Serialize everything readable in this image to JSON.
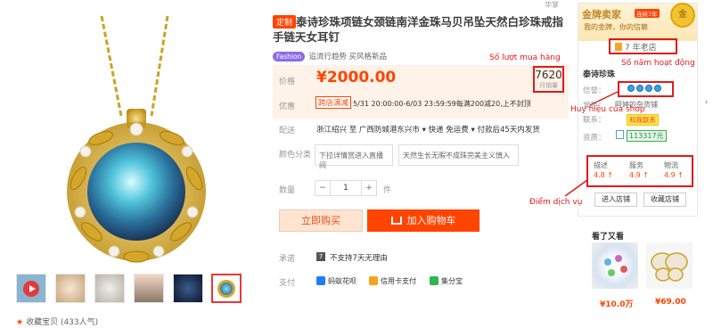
{
  "product": {
    "tag": "定制",
    "title": "泰诗珍珠项链女颈链南洋金珠马贝吊坠天然白珍珠戒指手链天女耳钉",
    "edge_text": "华掌",
    "trend": {
      "badge": "Fashion",
      "text": "追流行趋势 买风格新品"
    },
    "price_label": "价格",
    "price": "¥2000.00",
    "sales": {
      "count": "7620",
      "unit": "月销量"
    },
    "promo_label": "优惠",
    "promo_tag": "跨店满减",
    "promo_text": "5/31 20:00:00-6/03 23:59:59每满200减20,上不封顶",
    "ship_label": "配送",
    "ship_text": "浙江绍兴 至 广西防城港东兴市 ▾   快递 免运费 ▾   付款后45天内发货",
    "color_label": "颜色分类",
    "options": [
      "下拉详情赏进入直播间",
      "天然生长无暇不成珠完美主义慎入"
    ],
    "qty_label": "数量",
    "qty": {
      "minus": "−",
      "value": "1",
      "plus": "+",
      "unit": "件"
    },
    "buy_now": "立即购买",
    "add_cart": "加入购物车",
    "promise_label": "承诺",
    "promise_icon": "7",
    "promise_text": "不支持7天无理由",
    "pay_label": "支付",
    "payments": [
      {
        "label": "蚂蚁花呗",
        "color": "#1e7ef7"
      },
      {
        "label": "信用卡支付",
        "color": "#f7a21e"
      },
      {
        "label": "集分宝",
        "color": "#2db84d"
      }
    ],
    "favorite": "收藏宝贝 (433人气)"
  },
  "shop": {
    "level": "金牌卖家",
    "years_badge": "连续7年",
    "slogan": "我的金牌，你的信赖",
    "medal": "金",
    "years": "7 年老店",
    "name": "泰诗珍珠",
    "rating_label": "信誉：",
    "contact_label": "掌柜：",
    "contact_value": "阿婷的杂货铺",
    "contact2_label": "联系：",
    "contact_ww": "和我联系",
    "qual_label": "资质：",
    "qual_id": "113317元",
    "scores": [
      {
        "label": "描述",
        "value": "4.8 ↑"
      },
      {
        "label": "服务",
        "value": "4.9 ↑"
      },
      {
        "label": "物流",
        "value": "4.9 ↑"
      }
    ],
    "enter_shop": "进入店铺",
    "fav_shop": "收藏店铺"
  },
  "also_viewed": {
    "title": "看了又看",
    "items": [
      {
        "price": "¥10.0万"
      },
      {
        "price": "¥69.00"
      }
    ]
  },
  "annotations": {
    "sales": "Số lượt mua hàng",
    "years": "Số năm hoạt động",
    "rating": "Huy hiệu của shop",
    "scores": "Điểm dịch vụ"
  },
  "colors": {
    "accent": "#ff4400",
    "annotation": "#e21a1a"
  }
}
